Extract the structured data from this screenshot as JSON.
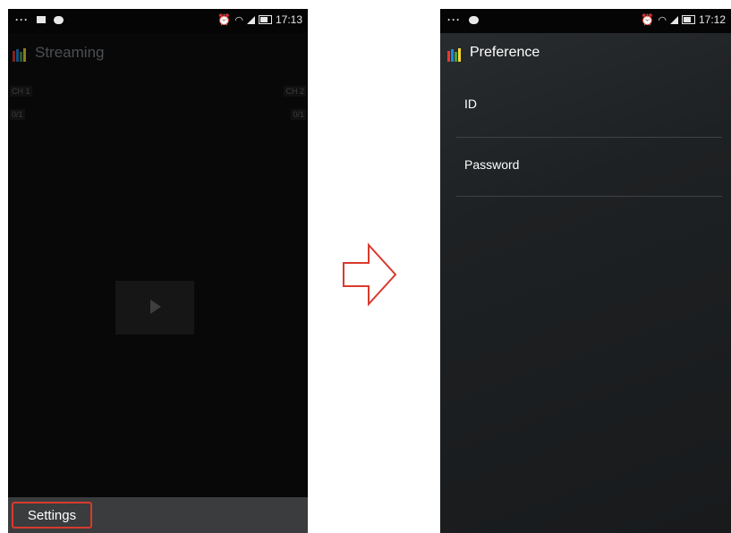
{
  "left_screen": {
    "status": {
      "time": "17:13"
    },
    "title": "Streaming",
    "channel_left": "CH 1",
    "channel_right": "CH 2",
    "sub_left": "0/1",
    "sub_right": "0/1",
    "settings_label": "Settings"
  },
  "right_screen": {
    "status": {
      "time": "17:12"
    },
    "title": "Preference",
    "items": [
      {
        "label": "ID"
      },
      {
        "label": "Password"
      }
    ]
  },
  "icons": {
    "status_left": [
      "more-icon",
      "image-icon",
      "message-icon"
    ],
    "status_right": [
      "alarm-icon",
      "wifi-icon",
      "signal-icon",
      "battery-icon"
    ],
    "transition": "arrow-right-icon",
    "play": "play-icon"
  },
  "colors": {
    "highlight": "#d83a2e",
    "app_icon_bars": [
      "#e53935",
      "#1e88e5",
      "#43a047",
      "#fdd835"
    ]
  }
}
